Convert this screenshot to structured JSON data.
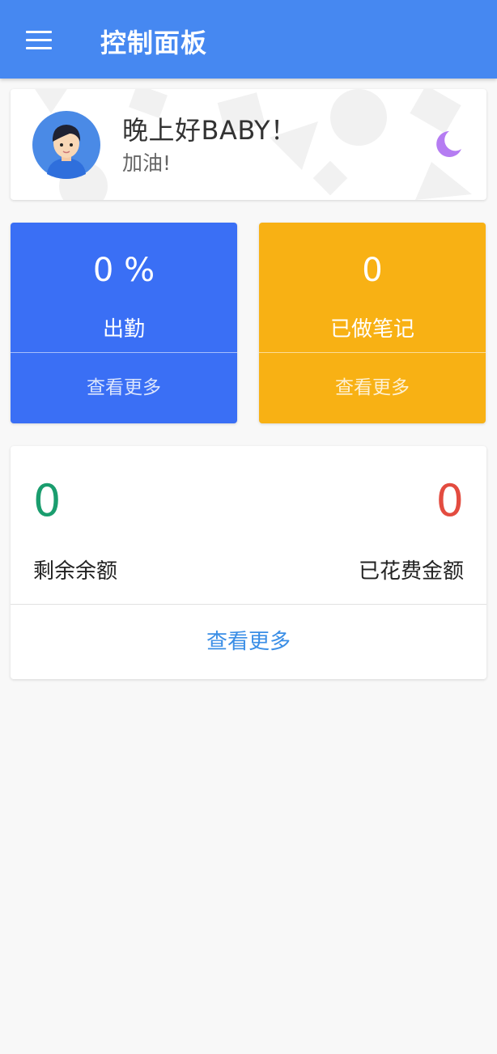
{
  "appbar": {
    "title": "控制面板",
    "menu_icon": "menu-icon",
    "color": "#4688f1"
  },
  "greeting": {
    "title": "晚上好BABY！",
    "subtitle": "加油!",
    "avatar_icon": "avatar",
    "moon_icon": "moon-icon",
    "moon_color": "#b57cf2"
  },
  "stats": [
    {
      "value": "0 %",
      "label": "出勤",
      "more": "查看更多",
      "color": "#3a6ff5"
    },
    {
      "value": "0",
      "label": "已做笔记",
      "more": "查看更多",
      "color": "#f8b114"
    }
  ],
  "balance": {
    "remaining_value": "0",
    "remaining_label": "剩余余额",
    "spent_value": "0",
    "spent_label": "已花费金额",
    "more": "查看更多",
    "remaining_color": "#1a9d6e",
    "spent_color": "#e34c40",
    "link_color": "#3a8ee6"
  }
}
